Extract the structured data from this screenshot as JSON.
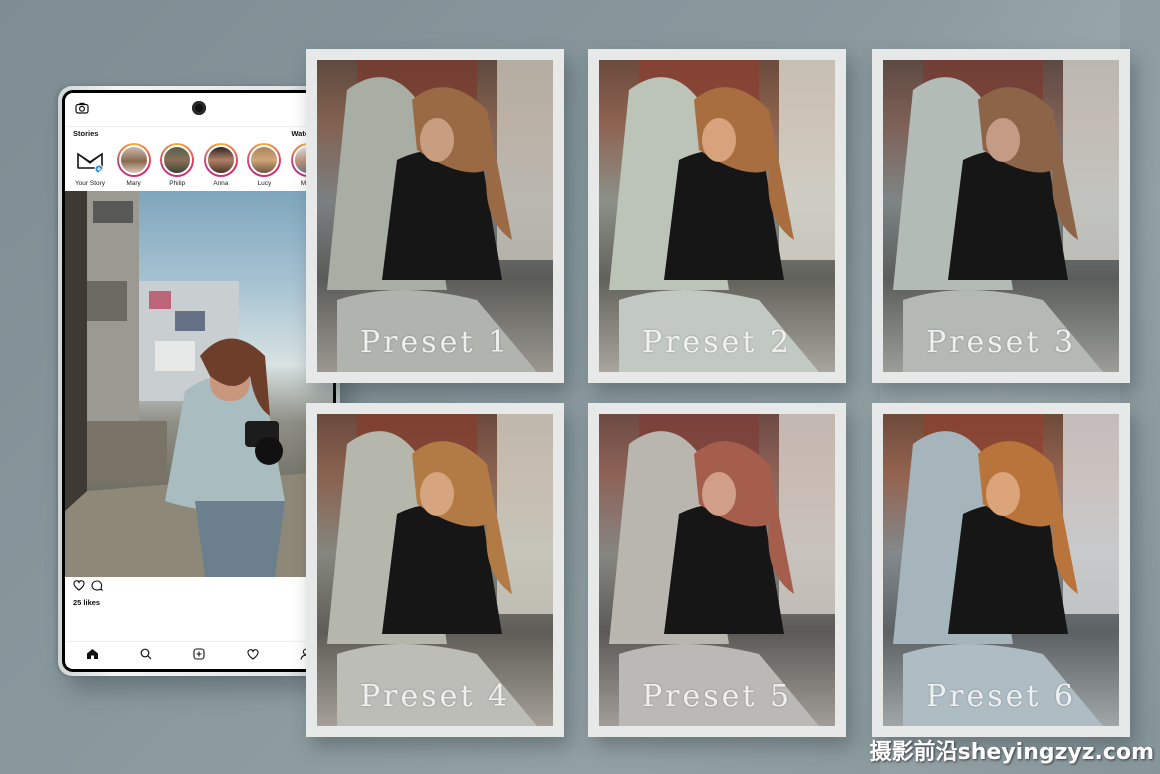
{
  "instagram": {
    "stories_title": "Stories",
    "watch_all": "Watch All",
    "stories": [
      {
        "label": "Your Story"
      },
      {
        "label": "Mary"
      },
      {
        "label": "Philip"
      },
      {
        "label": "Anna"
      },
      {
        "label": "Lucy"
      },
      {
        "label": "Mark"
      }
    ],
    "likes": "25 likes"
  },
  "presets": [
    {
      "label": "Preset 1"
    },
    {
      "label": "Preset 2"
    },
    {
      "label": "Preset 3"
    },
    {
      "label": "Preset 4"
    },
    {
      "label": "Preset 5"
    },
    {
      "label": "Preset 6"
    }
  ],
  "watermark": "摄影前沿sheyingzyz.com",
  "colors": {
    "background": "#869599",
    "card": "#e7e9e9",
    "story_ring": "#e2226b"
  }
}
